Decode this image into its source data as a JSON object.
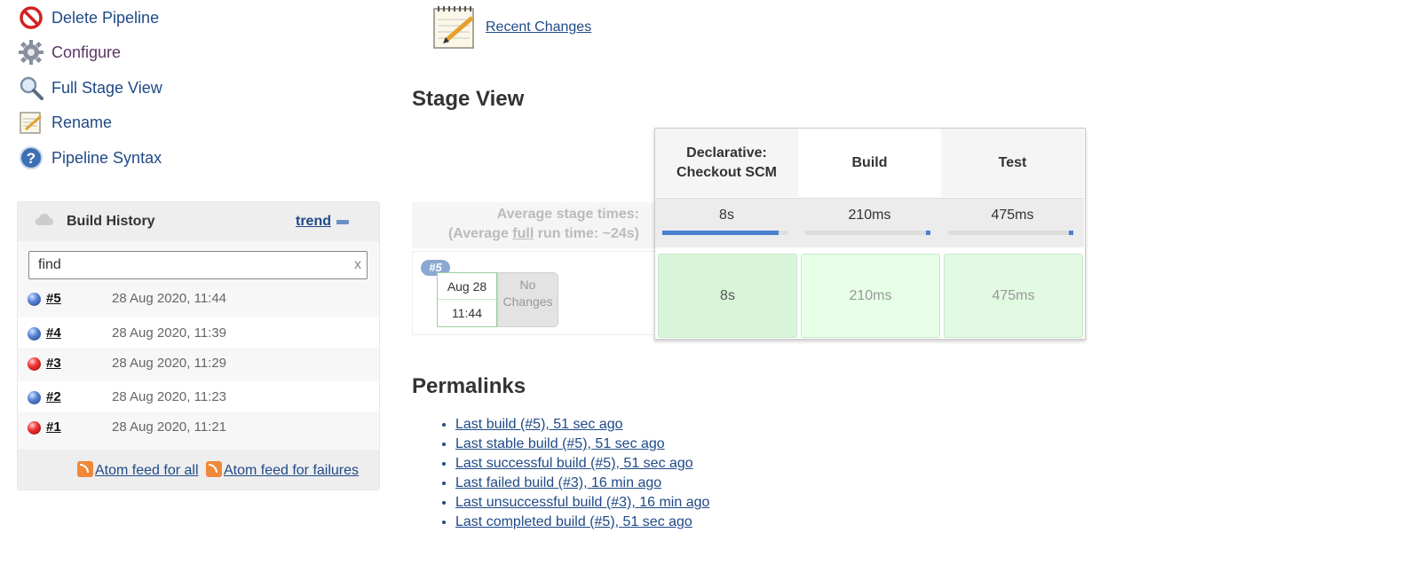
{
  "sidebar": {
    "tasks": [
      {
        "label": "Delete Pipeline",
        "icon": "delete-icon"
      },
      {
        "label": "Configure",
        "icon": "gear-icon"
      },
      {
        "label": "Full Stage View",
        "icon": "magnifier-icon"
      },
      {
        "label": "Rename",
        "icon": "notepad-icon"
      },
      {
        "label": "Pipeline Syntax",
        "icon": "help-icon"
      }
    ]
  },
  "build_history": {
    "title": "Build History",
    "trend_label": "trend",
    "search_value": "find",
    "clear_label": "x",
    "builds": [
      {
        "number": "#5",
        "date": "28 Aug 2020, 11:44",
        "status": "success",
        "color": "#3b6bc4"
      },
      {
        "number": "#4",
        "date": "28 Aug 2020, 11:39",
        "status": "success",
        "color": "#3b6bc4"
      },
      {
        "number": "#3",
        "date": "28 Aug 2020, 11:29",
        "status": "failed",
        "color": "#e33333"
      },
      {
        "number": "#2",
        "date": "28 Aug 2020, 11:23",
        "status": "success",
        "color": "#3b6bc4"
      },
      {
        "number": "#1",
        "date": "28 Aug 2020, 11:21",
        "status": "failed",
        "color": "#e33333"
      }
    ],
    "feed_all": "Atom feed for all",
    "feed_failures": "Atom feed for failures"
  },
  "main": {
    "recent_changes": "Recent Changes",
    "stage_view_title": "Stage View",
    "permalinks_title": "Permalinks"
  },
  "stage_view": {
    "avg_stage_times": "Average stage times:",
    "avg_full_prefix": "(Average ",
    "avg_full_link": "full",
    "avg_full_suffix": " run time: ~24s)",
    "run": {
      "badge": "#5",
      "date": "Aug 28",
      "time": "11:44",
      "changes_line1": "No",
      "changes_line2": "Changes"
    },
    "stages": [
      {
        "name_line1": "Declarative:",
        "name_line2": "Checkout SCM",
        "avg": "8s",
        "avg_fraction": 0.93,
        "run_time": "8s",
        "cell_color": "#d9f5d9",
        "text_color": "#555"
      },
      {
        "name_line1": "Build",
        "name_line2": "",
        "avg": "210ms",
        "avg_fraction": 0.03,
        "run_time": "210ms",
        "cell_color": "#e6ffe6",
        "text_color": "#999"
      },
      {
        "name_line1": "Test",
        "name_line2": "",
        "avg": "475ms",
        "avg_fraction": 0.05,
        "run_time": "475ms",
        "cell_color": "#e2f9e2",
        "text_color": "#999"
      }
    ]
  },
  "permalinks": [
    "Last build (#5), 51 sec ago",
    "Last stable build (#5), 51 sec ago",
    "Last successful build (#5), 51 sec ago",
    "Last failed build (#3), 16 min ago",
    "Last unsuccessful build (#3), 16 min ago",
    "Last completed build (#5), 51 sec ago"
  ],
  "colors": {
    "link": "#204a87",
    "success_ball": "#3b6bc4",
    "failure_ball": "#e33333",
    "rss": "#f0883a"
  }
}
